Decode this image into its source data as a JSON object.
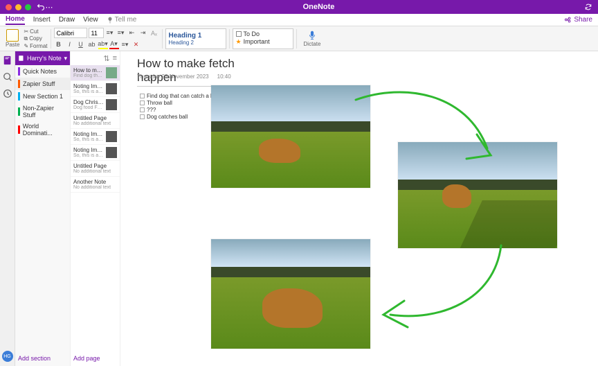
{
  "app": {
    "title": "OneNote"
  },
  "menu": {
    "items": [
      "Home",
      "Insert",
      "Draw",
      "View"
    ],
    "tellme": "Tell me",
    "share": "Share",
    "active": "Home"
  },
  "ribbon": {
    "paste": "Paste",
    "clip": {
      "cut": "Cut",
      "copy": "Copy",
      "format": "Format"
    },
    "font": {
      "name": "Calibri",
      "size": "11"
    },
    "styles": {
      "h1": "Heading 1",
      "h2": "Heading 2"
    },
    "tags": {
      "todo": "To Do",
      "important": "Important"
    },
    "dictate": "Dictate"
  },
  "notebook": {
    "name": "Harry's Notebook"
  },
  "sections": [
    {
      "label": "Quick Notes",
      "color": "#8a2be2"
    },
    {
      "label": "Zapier Stuff",
      "color": "#ff5a00"
    },
    {
      "label": "New Section 1",
      "color": "#00b0f0"
    },
    {
      "label": "Non-Zapier Stuff",
      "color": "#00b050"
    },
    {
      "label": "World Dominati...",
      "color": "#ff0000"
    }
  ],
  "add_section": "Add section",
  "add_page": "Add page",
  "pages": [
    {
      "title": "How to ma...",
      "sub": "Find dog that...",
      "thumb": "dog"
    },
    {
      "title": "Noting Imp...",
      "sub": "So, this is a s...",
      "thumb": "face"
    },
    {
      "title": "Dog Christ...",
      "sub": "Dog food  Fa...",
      "thumb": "face"
    },
    {
      "title": "Untitled Page",
      "sub": "No additional text",
      "thumb": ""
    },
    {
      "title": "Noting Imp...",
      "sub": "So, this is a s...",
      "thumb": "face"
    },
    {
      "title": "Noting Imp...",
      "sub": "So, this is a s...",
      "thumb": "face"
    },
    {
      "title": "Untitled Page",
      "sub": "No additional text",
      "thumb": ""
    },
    {
      "title": "Another Note",
      "sub": "No additional text",
      "thumb": ""
    }
  ],
  "note": {
    "title": "How to make fetch happen",
    "date": "Thursday 23 November 2023",
    "time": "10:40",
    "todos": [
      "Find dog that can catch a ball",
      "Throw ball",
      "???",
      "Dog catches ball"
    ]
  },
  "avatar": "HG"
}
